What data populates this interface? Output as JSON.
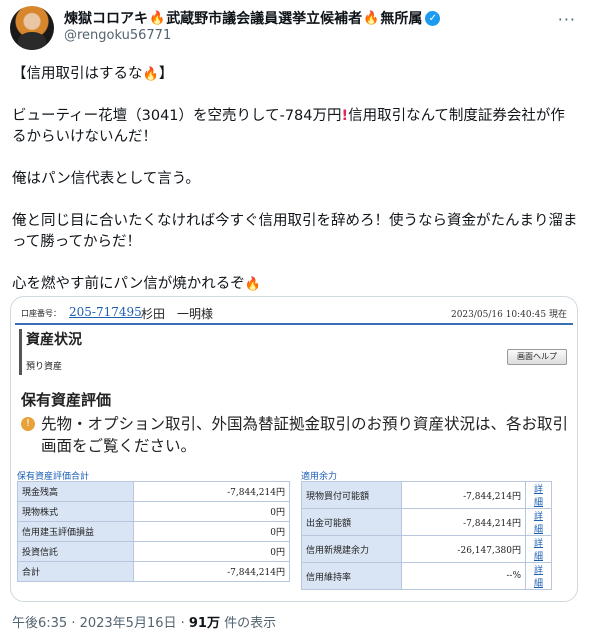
{
  "author": {
    "name": "煉獄コロアキ",
    "name_suffix": "武蔵野市議会議員選挙立候補者",
    "name_tail": "無所属",
    "handle": "@rengoku56771"
  },
  "tweet": {
    "line1": "【信用取引はするな",
    "line1_end": "】",
    "line2a": "ビューティー花壇（3041）を空売りして-784万円",
    "line2b": "信用取引なんて制度証券会社が作るからいけないんだ！",
    "line3": "俺はパン信代表として言う。",
    "line4": "俺と同じ目に合いたくなければ今すぐ信用取引を辞めろ！使うなら資金がたんまり溜まって勝ってからだ！",
    "line5": "心を燃やす前にパン信が焼かれるぞ"
  },
  "screenshot": {
    "acct_label": "口座番号：",
    "acct_number": "205-717495",
    "holder": "杉田　一明様",
    "datetime": "2023/05/16 10:40:45 現在",
    "page_title": "資産状況",
    "page_subtitle": "預り資産",
    "help_label": "画面ヘルプ",
    "section_heading": "保有資産評価",
    "notice_icon": "!",
    "notice": "先物・オプション取引、外国為替証拠金取引のお預り資産状況は、各お取引画面をご覧ください。",
    "left_table": {
      "title": "保有資産評価合計",
      "rows": [
        {
          "label": "現金残高",
          "value": "-7,844,214円"
        },
        {
          "label": "現物株式",
          "value": "0円"
        },
        {
          "label": "信用建玉評価損益",
          "value": "0円"
        },
        {
          "label": "投資信託",
          "value": "0円"
        },
        {
          "label": "合計",
          "value": "-7,844,214円"
        }
      ]
    },
    "right_table": {
      "title": "適用余力",
      "link_label": "詳細",
      "rows": [
        {
          "label": "現物買付可能額",
          "value": "-7,844,214円"
        },
        {
          "label": "出金可能額",
          "value": "-7,844,214円"
        },
        {
          "label": "信用新規建余力",
          "value": "-26,147,380円"
        },
        {
          "label": "信用維持率",
          "value": "--%"
        }
      ]
    }
  },
  "footer": {
    "time": "午後6:35 · 2023年5月16日 · ",
    "views": "91万",
    "views_suffix": " 件の表示"
  },
  "icons": {
    "flame": "flame-emoji",
    "exclamation": "red-exclamation-emoji",
    "verified": "verified-badge",
    "more": "more-options"
  },
  "colors": {
    "link": "#1b5fb3",
    "flame": "#f25c05",
    "verified": "#1d9bf0",
    "table_header": "#d9e5f4"
  }
}
